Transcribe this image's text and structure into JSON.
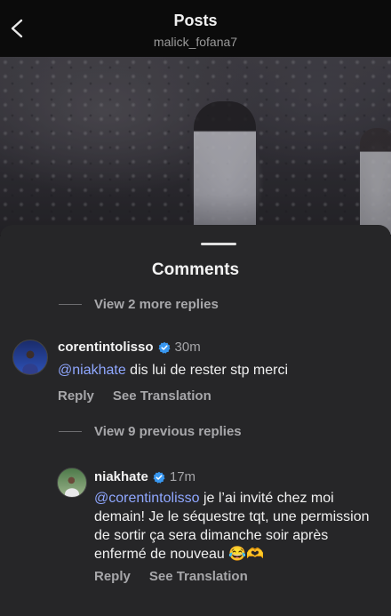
{
  "header": {
    "title": "Posts",
    "subtitle": "malick_fofana7"
  },
  "sheet": {
    "title": "Comments"
  },
  "threads": {
    "more_replies_1": "View 2 more replies",
    "more_replies_2": "View 9 previous replies"
  },
  "comments": [
    {
      "username": "corentintolisso",
      "time": "30m",
      "mention": "@niakhate",
      "text": " dis lui de rester stp merci",
      "reply_label": "Reply",
      "translate_label": "See Translation"
    },
    {
      "username": "niakhate",
      "time": "17m",
      "mention": "@corentintolisso",
      "text": " je l’ai invité chez moi demain! Je le séquestre tqt, une permission de sortir ça sera dimanche soir après enfermé de nouveau 😂🫶",
      "reply_label": "Reply",
      "translate_label": "See Translation"
    }
  ],
  "colors": {
    "accent_mention": "#8fa7ff",
    "verified": "#3897f0",
    "sheet_bg": "#262628"
  }
}
